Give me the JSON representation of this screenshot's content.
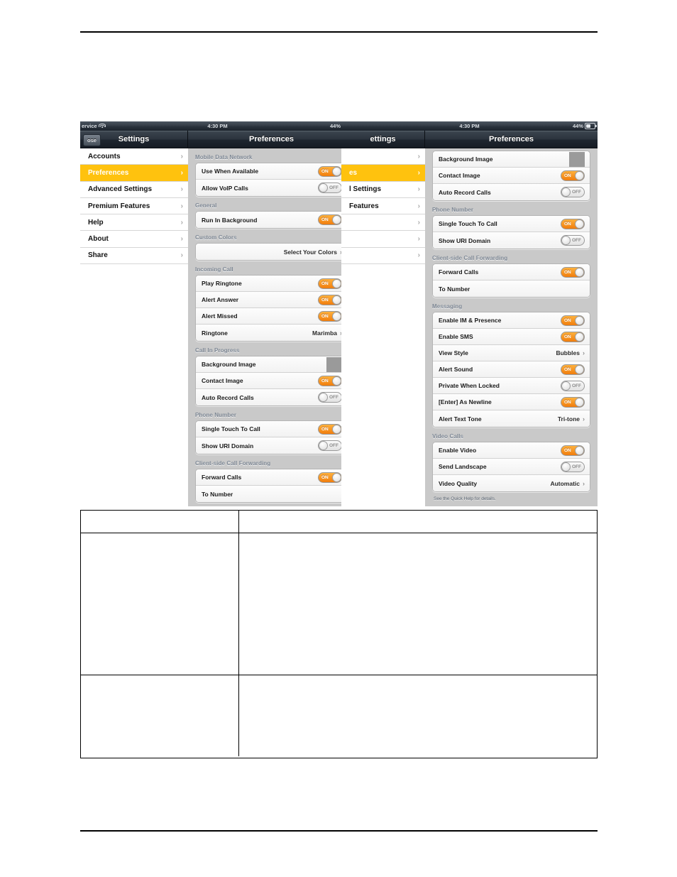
{
  "document": {
    "header_rule": true,
    "footer_rule": true
  },
  "status_bar": {
    "carrier": "ervice",
    "wifi_icon": "wifi-icon",
    "time": "4:30 PM",
    "battery_percent": "44%",
    "battery_icon": "battery-icon"
  },
  "screenshot_left": {
    "close_button": "ose",
    "sidebar_title": "Settings",
    "detail_title": "Preferences",
    "sidebar_items": [
      {
        "label": "Accounts",
        "selected": false,
        "chevron": "›"
      },
      {
        "label": "Preferences",
        "selected": true,
        "chevron": "›"
      },
      {
        "label": "Advanced Settings",
        "selected": false,
        "chevron": "›"
      },
      {
        "label": "Premium Features",
        "selected": false,
        "chevron": "›"
      },
      {
        "label": "Help",
        "selected": false,
        "chevron": "›"
      },
      {
        "label": "About",
        "selected": false,
        "chevron": "›"
      },
      {
        "label": "Share",
        "selected": false,
        "chevron": "›"
      }
    ],
    "groups": [
      {
        "header": "Mobile Data Network",
        "rows": [
          {
            "label": "Use When Available",
            "control": "toggle",
            "state": "ON"
          },
          {
            "label": "Allow VoIP Calls",
            "control": "toggle",
            "state": "OFF"
          }
        ]
      },
      {
        "header": "General",
        "rows": [
          {
            "label": "Run In Background",
            "control": "toggle",
            "state": "ON"
          }
        ]
      },
      {
        "header": "Custom Colors",
        "rows": [
          {
            "label": "",
            "control": "disclosure",
            "value": "Select Your Colors",
            "chevron": "›"
          }
        ]
      },
      {
        "header": "Incoming Call",
        "rows": [
          {
            "label": "Play Ringtone",
            "control": "toggle",
            "state": "ON"
          },
          {
            "label": "Alert Answer",
            "control": "toggle",
            "state": "ON"
          },
          {
            "label": "Alert Missed",
            "control": "toggle",
            "state": "ON"
          },
          {
            "label": "Ringtone",
            "control": "disclosure",
            "value": "Marimba",
            "chevron": "›"
          }
        ]
      },
      {
        "header": "Call In Progress",
        "rows": [
          {
            "label": "Background Image",
            "control": "swatch",
            "value": ""
          },
          {
            "label": "Contact Image",
            "control": "toggle",
            "state": "ON"
          },
          {
            "label": "Auto Record Calls",
            "control": "toggle",
            "state": "OFF"
          }
        ]
      },
      {
        "header": "Phone Number",
        "rows": [
          {
            "label": "Single Touch To Call",
            "control": "toggle",
            "state": "ON"
          },
          {
            "label": "Show URI Domain",
            "control": "toggle",
            "state": "OFF"
          }
        ]
      },
      {
        "header": "Client-side Call Forwarding",
        "rows": [
          {
            "label": "Forward Calls",
            "control": "toggle",
            "state": "ON"
          },
          {
            "label": "To Number",
            "control": "none",
            "value": ""
          }
        ]
      }
    ]
  },
  "screenshot_right": {
    "sidebar_title": "ettings",
    "detail_title": "Preferences",
    "sidebar_items": [
      {
        "label": "",
        "selected": false,
        "chevron": "›"
      },
      {
        "label": "es",
        "selected": true,
        "chevron": "›"
      },
      {
        "label": "l Settings",
        "selected": false,
        "chevron": "›"
      },
      {
        "label": "Features",
        "selected": false,
        "chevron": "›"
      },
      {
        "label": "",
        "selected": false,
        "chevron": "›"
      },
      {
        "label": "",
        "selected": false,
        "chevron": "›"
      },
      {
        "label": "",
        "selected": false,
        "chevron": "›"
      }
    ],
    "groups": [
      {
        "header": "",
        "rows": [
          {
            "label": "Background Image",
            "control": "swatch",
            "value": ""
          },
          {
            "label": "Contact Image",
            "control": "toggle",
            "state": "ON"
          },
          {
            "label": "Auto Record Calls",
            "control": "toggle",
            "state": "OFF"
          }
        ]
      },
      {
        "header": "Phone Number",
        "rows": [
          {
            "label": "Single Touch To Call",
            "control": "toggle",
            "state": "ON"
          },
          {
            "label": "Show URI Domain",
            "control": "toggle",
            "state": "OFF"
          }
        ]
      },
      {
        "header": "Client-side Call Forwarding",
        "rows": [
          {
            "label": "Forward Calls",
            "control": "toggle",
            "state": "ON"
          },
          {
            "label": "To Number",
            "control": "none",
            "value": ""
          }
        ]
      },
      {
        "header": "Messaging",
        "rows": [
          {
            "label": "Enable IM & Presence",
            "control": "toggle",
            "state": "ON"
          },
          {
            "label": "Enable SMS",
            "control": "toggle",
            "state": "ON"
          },
          {
            "label": "View Style",
            "control": "disclosure",
            "value": "Bubbles",
            "chevron": "›"
          },
          {
            "label": "Alert Sound",
            "control": "toggle",
            "state": "ON"
          },
          {
            "label": "Private When Locked",
            "control": "toggle",
            "state": "OFF"
          },
          {
            "label": "[Enter] As Newline",
            "control": "toggle",
            "state": "ON"
          },
          {
            "label": "Alert Text Tone",
            "control": "disclosure",
            "value": "Tri-tone",
            "chevron": "›"
          }
        ]
      },
      {
        "header": "Video Calls",
        "rows": [
          {
            "label": "Enable Video",
            "control": "toggle",
            "state": "ON"
          },
          {
            "label": "Send Landscape",
            "control": "toggle",
            "state": "OFF"
          },
          {
            "label": "Video Quality",
            "control": "disclosure",
            "value": "Automatic",
            "chevron": "›"
          }
        ]
      }
    ],
    "footer_note": "See the Quick Help for details."
  },
  "table": {
    "rows": [
      {
        "left": "",
        "right": ""
      },
      {
        "left": "",
        "right": ""
      },
      {
        "left": "",
        "right": ""
      }
    ]
  },
  "colors": {
    "accent": "#ffc20e",
    "toggle_on": "#f07d0d",
    "navbar": "#2b333d",
    "detail_bg": "#c9c9c9"
  }
}
